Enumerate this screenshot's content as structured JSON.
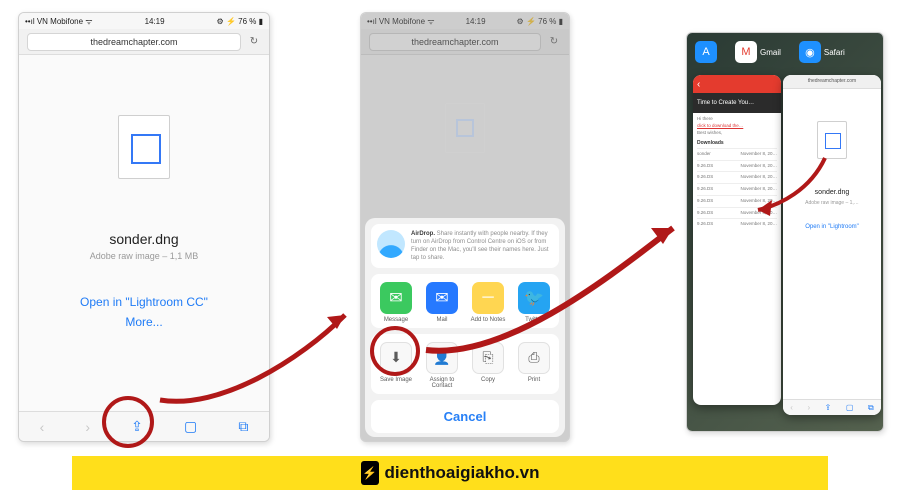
{
  "status": {
    "carrier": "••ıl VN Mobifone ᯤ",
    "time": "14:19",
    "battery": "⚙ ⚡ 76 % ▮"
  },
  "url": "thedreamchapter.com",
  "file": {
    "name": "sonder.dng",
    "meta": "Adobe raw image – 1,1 MB",
    "meta_short": "Adobe raw image – 1,…"
  },
  "links": {
    "openin": "Open in \"Lightroom CC\"",
    "openin_short": "Open in \"Lightroom\"",
    "more": "More..."
  },
  "share": {
    "airdrop_label": "AirDrop.",
    "airdrop_text": "Share instantly with people nearby. If they turn on AirDrop from Control Centre on iOS or from Finder on the Mac, you'll see their names here. Just tap to share.",
    "apps": [
      {
        "label": "Message",
        "color": "#34c759",
        "glyph": "✉"
      },
      {
        "label": "Mail",
        "color": "#1e74ff",
        "glyph": "✉"
      },
      {
        "label": "Add to Notes",
        "color": "#ffd54a",
        "glyph": "─"
      },
      {
        "label": "Twitter",
        "color": "#1da1f2",
        "glyph": "🐦"
      }
    ],
    "actions": [
      {
        "label": "Save Image",
        "glyph": "⬇"
      },
      {
        "label": "Assign to Contact",
        "glyph": "👤"
      },
      {
        "label": "Copy",
        "glyph": "⎘"
      },
      {
        "label": "Print",
        "glyph": "⎙"
      }
    ],
    "cancel": "Cancel"
  },
  "switcher": {
    "apps": [
      {
        "label": "Gmail",
        "color": "#fff"
      },
      {
        "label": "Safari",
        "color": "#1e90ff"
      }
    ],
    "gmail_banner": "Time to Create You…",
    "gmail_heading": "Downloads",
    "gmail_rows": [
      {
        "a": "sonder",
        "b": "November 8, 20…"
      },
      {
        "a": "9.26.DS",
        "b": "November 8, 20…"
      },
      {
        "a": "9.26.DS",
        "b": "November 8, 20…"
      },
      {
        "a": "9.26.DS",
        "b": "November 8, 20…"
      },
      {
        "a": "9.26.DS",
        "b": "November 8, 20…"
      },
      {
        "a": "9.26.DS",
        "b": "November 8, 20…"
      },
      {
        "a": "9.26.DS",
        "b": "November 8, 20…"
      }
    ]
  },
  "footer": {
    "badge": "⚡",
    "text": "dienthoaigiakho.vn"
  }
}
